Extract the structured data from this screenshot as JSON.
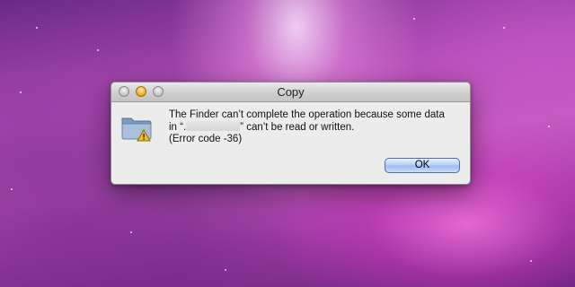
{
  "window": {
    "title": "Copy"
  },
  "dialog": {
    "message_line1": "The Finder can’t complete the operation because some data",
    "message_line2_prefix": "in “.",
    "message_line2_suffix": "” can’t be read or written.",
    "message_line3": "(Error code -36)",
    "icon": "folder-warning-icon"
  },
  "buttons": {
    "ok_label": "OK"
  },
  "colors": {
    "default_button": "#9bbcec",
    "warning_badge": "#f2c417"
  }
}
